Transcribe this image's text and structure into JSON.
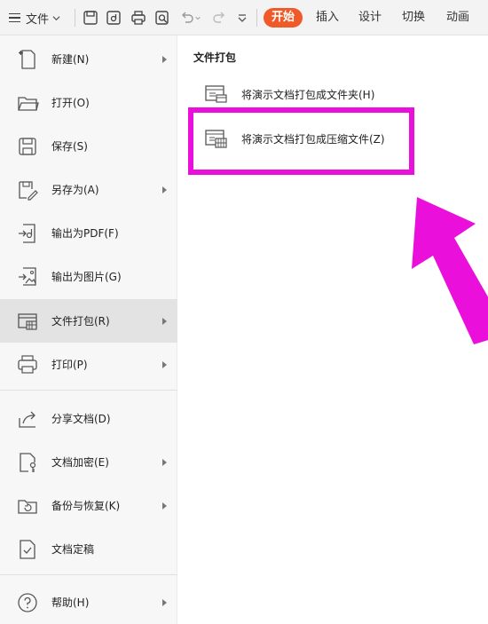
{
  "toolbar": {
    "file_label": "文件",
    "tabs": [
      {
        "label": "开始",
        "active": true
      },
      {
        "label": "插入"
      },
      {
        "label": "设计"
      },
      {
        "label": "切换"
      },
      {
        "label": "动画"
      }
    ],
    "accent_color": "#f05a28"
  },
  "menu": {
    "items": [
      {
        "label": "新建(N)",
        "icon": "new-file-icon",
        "has_submenu": true
      },
      {
        "label": "打开(O)",
        "icon": "folder-open-icon",
        "has_submenu": false
      },
      {
        "label": "保存(S)",
        "icon": "save-icon",
        "has_submenu": false
      },
      {
        "label": "另存为(A)",
        "icon": "save-as-icon",
        "has_submenu": true
      },
      {
        "label": "输出为PDF(F)",
        "icon": "export-pdf-icon",
        "has_submenu": false
      },
      {
        "label": "输出为图片(G)",
        "icon": "export-image-icon",
        "has_submenu": false
      },
      {
        "label": "文件打包(R)",
        "icon": "file-package-icon",
        "has_submenu": true,
        "selected": true
      },
      {
        "label": "打印(P)",
        "icon": "printer-icon",
        "has_submenu": true
      },
      {
        "label": "分享文档(D)",
        "icon": "share-icon",
        "has_submenu": false
      },
      {
        "label": "文档加密(E)",
        "icon": "encrypt-icon",
        "has_submenu": true
      },
      {
        "label": "备份与恢复(K)",
        "icon": "backup-restore-icon",
        "has_submenu": true
      },
      {
        "label": "文档定稿",
        "icon": "finalize-icon",
        "has_submenu": false
      },
      {
        "label": "帮助(H)",
        "icon": "help-icon",
        "has_submenu": true
      }
    ]
  },
  "submenu": {
    "title": "文件打包",
    "items": [
      {
        "label": "将演示文档打包成文件夹(H)",
        "icon": "package-folder-icon"
      },
      {
        "label": "将演示文档打包成压缩文件(Z)",
        "icon": "package-zip-icon"
      }
    ]
  },
  "annotation": {
    "highlight_color": "#ea0fdb"
  }
}
